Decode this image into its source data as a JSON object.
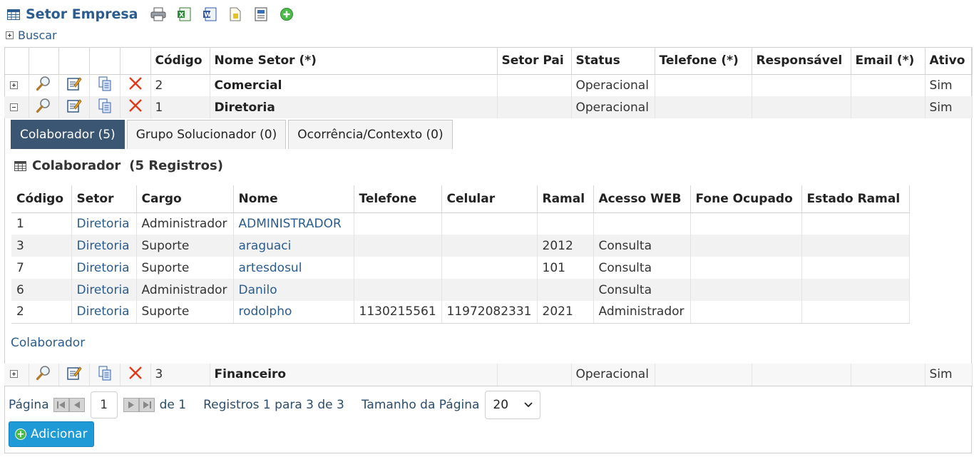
{
  "header": {
    "title": "Setor Empresa",
    "toolbar": [
      "print-icon",
      "excel-export-icon",
      "word-export-icon",
      "pdf-export-icon",
      "report-icon",
      "add-icon"
    ]
  },
  "search": {
    "label": "Buscar"
  },
  "main_table": {
    "columns": [
      "Código",
      "Nome Setor (*)",
      "Setor Pai",
      "Status",
      "Telefone (*)",
      "Responsável",
      "Email (*)",
      "Ativo"
    ],
    "rows": [
      {
        "codigo": "2",
        "nome": "Comercial",
        "setor_pai": "",
        "status": "Operacional",
        "telefone": "",
        "responsavel": "",
        "email": "",
        "ativo": "Sim",
        "expanded": false
      },
      {
        "codigo": "1",
        "nome": "Diretoria",
        "setor_pai": "",
        "status": "Operacional",
        "telefone": "",
        "responsavel": "",
        "email": "",
        "ativo": "Sim",
        "expanded": true
      },
      {
        "codigo": "3",
        "nome": "Financeiro",
        "setor_pai": "",
        "status": "Operacional",
        "telefone": "",
        "responsavel": "",
        "email": "",
        "ativo": "Sim",
        "expanded": false
      }
    ]
  },
  "detail": {
    "tabs": [
      {
        "label": "Colaborador (5)",
        "active": true
      },
      {
        "label": "Grupo Solucionador (0)",
        "active": false
      },
      {
        "label": "Ocorrência/Contexto (0)",
        "active": false
      }
    ],
    "title": "Colaborador",
    "count_label": "(5 Registros)",
    "columns": [
      "Código",
      "Setor",
      "Cargo",
      "Nome",
      "Telefone",
      "Celular",
      "Ramal",
      "Acesso WEB",
      "Fone Ocupado",
      "Estado Ramal"
    ],
    "rows": [
      [
        "1",
        "Diretoria",
        "Administrador",
        "ADMINISTRADOR",
        "",
        "",
        "",
        "",
        "",
        ""
      ],
      [
        "3",
        "Diretoria",
        "Suporte",
        "araguaci",
        "",
        "",
        "2012",
        "Consulta",
        "",
        ""
      ],
      [
        "7",
        "Diretoria",
        "Suporte",
        "artesdosul",
        "",
        "",
        "101",
        "Consulta",
        "",
        ""
      ],
      [
        "6",
        "Diretoria",
        "Administrador",
        "Danilo",
        "",
        "",
        "",
        "Consulta",
        "",
        ""
      ],
      [
        "2",
        "Diretoria",
        "Suporte",
        "rodolpho",
        "1130215561",
        "11972082331",
        "2021",
        "Administrador",
        "",
        ""
      ]
    ],
    "footer_link": "Colaborador"
  },
  "pager": {
    "page_label": "Página",
    "page_value": "1",
    "of_label": "de 1",
    "records_label": "Registros 1 para 3 de 3",
    "size_label": "Tamanho da Página",
    "size_value": "20"
  },
  "add_button": {
    "label": "Adicionar"
  },
  "colors": {
    "accent": "#2a5c8f",
    "tab_active": "#3b5672",
    "add_button": "#1e9ad6",
    "delete": "#e03a1a"
  }
}
